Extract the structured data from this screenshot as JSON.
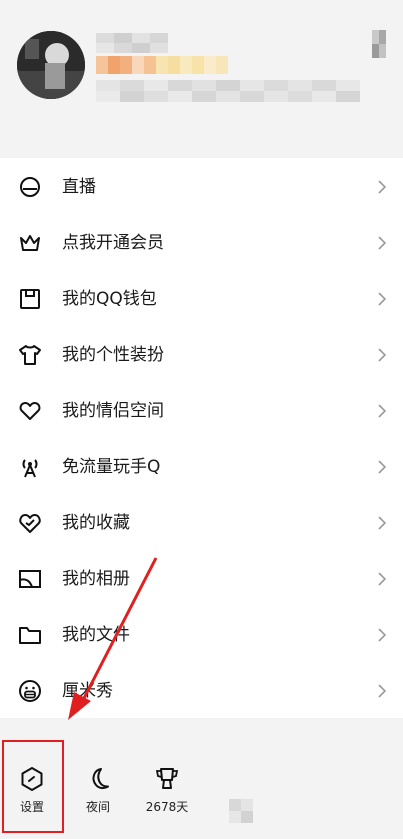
{
  "menu": {
    "items": [
      {
        "label": "直播",
        "icon": "live-icon"
      },
      {
        "label": "点我开通会员",
        "icon": "crown-icon"
      },
      {
        "label": "我的QQ钱包",
        "icon": "wallet-icon"
      },
      {
        "label": "我的个性装扮",
        "icon": "shirt-icon"
      },
      {
        "label": "我的情侣空间",
        "icon": "heart-icon"
      },
      {
        "label": "免流量玩手Q",
        "icon": "antenna-icon"
      },
      {
        "label": "我的收藏",
        "icon": "favorite-icon"
      },
      {
        "label": "我的相册",
        "icon": "album-icon"
      },
      {
        "label": "我的文件",
        "icon": "folder-icon"
      },
      {
        "label": "厘米秀",
        "icon": "cmshow-icon"
      }
    ]
  },
  "bottom": {
    "settings_label": "设置",
    "night_label": "夜间",
    "days_label": "2678天"
  },
  "colors": {
    "highlight": "#e02020",
    "arrow": "#e02020"
  }
}
